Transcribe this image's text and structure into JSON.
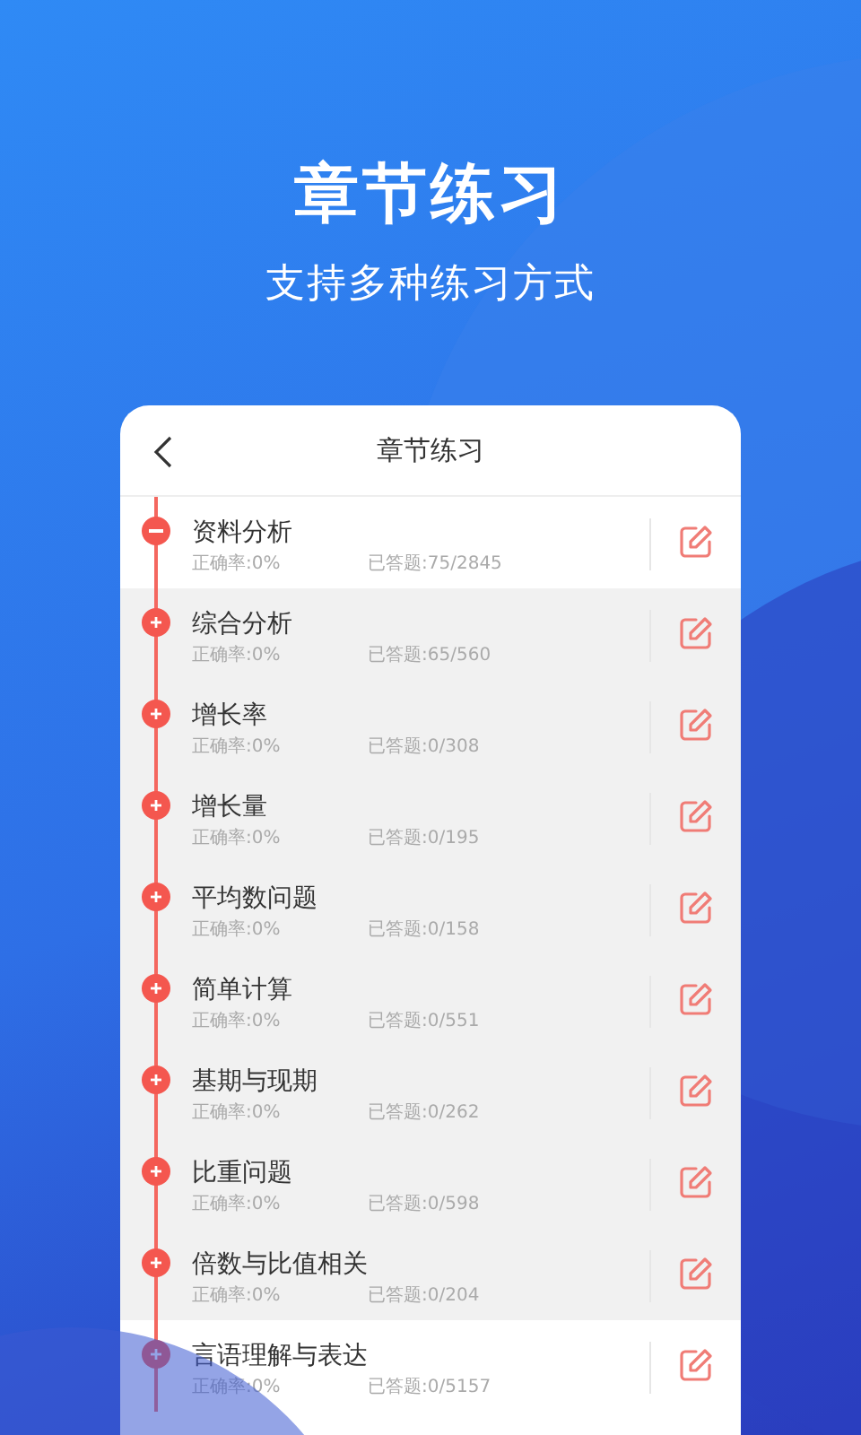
{
  "promo": {
    "title": "章节练习",
    "subtitle": "支持多种练习方式"
  },
  "screen": {
    "title": "章节练习"
  },
  "chapters": [
    {
      "title": "资料分析",
      "accuracy": "正确率:0%",
      "answered": "已答题:75/2845",
      "expanded": true,
      "children": [
        {
          "title": "综合分析",
          "accuracy": "正确率:0%",
          "answered": "已答题:65/560",
          "expanded": false
        },
        {
          "title": "增长率",
          "accuracy": "正确率:0%",
          "answered": "已答题:0/308",
          "expanded": false
        },
        {
          "title": "增长量",
          "accuracy": "正确率:0%",
          "answered": "已答题:0/195",
          "expanded": false
        },
        {
          "title": "平均数问题",
          "accuracy": "正确率:0%",
          "answered": "已答题:0/158",
          "expanded": false
        },
        {
          "title": "简单计算",
          "accuracy": "正确率:0%",
          "answered": "已答题:0/551",
          "expanded": false
        },
        {
          "title": "基期与现期",
          "accuracy": "正确率:0%",
          "answered": "已答题:0/262",
          "expanded": false
        },
        {
          "title": "比重问题",
          "accuracy": "正确率:0%",
          "answered": "已答题:0/598",
          "expanded": false
        },
        {
          "title": "倍数与比值相关",
          "accuracy": "正确率:0%",
          "answered": "已答题:0/204",
          "expanded": false
        }
      ]
    },
    {
      "title": "言语理解与表达",
      "accuracy": "正确率:0%",
      "answered": "已答题:0/5157",
      "expanded": false
    }
  ]
}
